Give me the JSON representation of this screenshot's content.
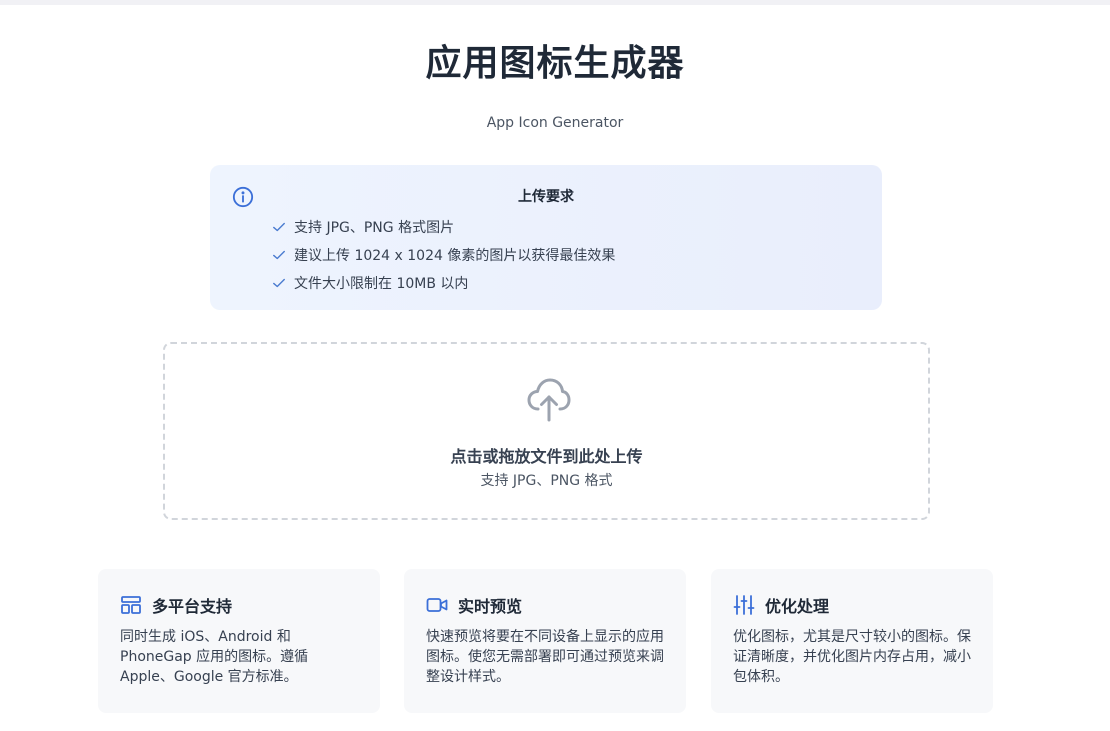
{
  "header": {
    "title": "应用图标生成器",
    "subtitle": "App Icon Generator"
  },
  "requirements": {
    "title": "上传要求",
    "items": [
      "支持 JPG、PNG 格式图片",
      "建议上传 1024 x 1024 像素的图片以获得最佳效果",
      "文件大小限制在 10MB 以内"
    ]
  },
  "upload": {
    "title": "点击或拖放文件到此处上传",
    "subtitle": "支持 JPG、PNG 格式"
  },
  "features": [
    {
      "title": "多平台支持",
      "description": "同时生成 iOS、Android 和 PhoneGap 应用的图标。遵循 Apple、Google 官方标准。",
      "icon": "layout-icon"
    },
    {
      "title": "实时预览",
      "description": "快速预览将要在不同设备上显示的应用图标。使您无需部署即可通过预览来调整设计样式。",
      "icon": "video-icon"
    },
    {
      "title": "优化处理",
      "description": "优化图标，尤其是尺寸较小的图标。保证清晰度，并优化图片内存占用，减小包体积。",
      "icon": "sliders-icon"
    }
  ],
  "colors": {
    "accent": "#3b6fd8",
    "check": "#4a7bd0",
    "upload_icon": "#9ca3af"
  }
}
